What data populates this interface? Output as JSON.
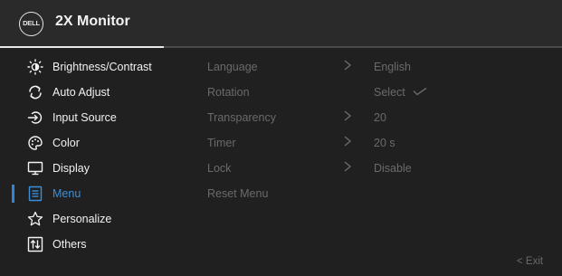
{
  "header": {
    "logo_text": "DELL",
    "title": "2X Monitor"
  },
  "colors": {
    "background": "#202020",
    "header_bg": "#2a2a2a",
    "accent": "#2f86d8",
    "text": "#f2f2f2",
    "muted": "#6a6a6a"
  },
  "sidebar": {
    "active_index": 5,
    "items": [
      {
        "label": "Brightness/Contrast",
        "icon": "brightness-icon"
      },
      {
        "label": "Auto Adjust",
        "icon": "auto-adjust-icon"
      },
      {
        "label": "Input Source",
        "icon": "input-source-icon"
      },
      {
        "label": "Color",
        "icon": "color-palette-icon"
      },
      {
        "label": "Display",
        "icon": "display-icon"
      },
      {
        "label": "Menu",
        "icon": "menu-icon"
      },
      {
        "label": "Personalize",
        "icon": "star-icon"
      },
      {
        "label": "Others",
        "icon": "others-icon"
      }
    ]
  },
  "menu_settings": {
    "rows": [
      {
        "label": "Language",
        "chevron": true,
        "value": "English",
        "check": false
      },
      {
        "label": "Rotation",
        "chevron": false,
        "value": "Select",
        "check": true
      },
      {
        "label": "Transparency",
        "chevron": true,
        "value": "20",
        "check": false
      },
      {
        "label": "Timer",
        "chevron": true,
        "value": "20 s",
        "check": false
      },
      {
        "label": "Lock",
        "chevron": true,
        "value": "Disable",
        "check": false
      },
      {
        "label": "Reset Menu",
        "chevron": false,
        "value": "",
        "check": false
      }
    ]
  },
  "footer": {
    "exit_label": "< Exit"
  }
}
